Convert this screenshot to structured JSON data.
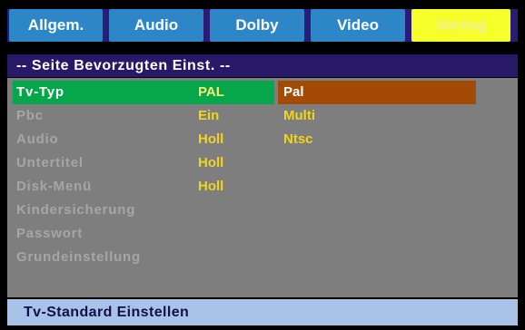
{
  "tabs": [
    {
      "label": "Allgem."
    },
    {
      "label": "Audio"
    },
    {
      "label": "Dolby"
    },
    {
      "label": "Video"
    },
    {
      "label": "Vorzug"
    }
  ],
  "header": {
    "title": "-- Seite Bevorzugten Einst. --"
  },
  "menu": {
    "items": [
      {
        "label": "Tv-Typ",
        "value": "PAL"
      },
      {
        "label": "Pbc",
        "value": "Ein"
      },
      {
        "label": "Audio",
        "value": "Holl"
      },
      {
        "label": "Untertitel",
        "value": "Holl"
      },
      {
        "label": "Disk-Menü",
        "value": "Holl"
      },
      {
        "label": "Kindersicherung",
        "value": ""
      },
      {
        "label": "Passwort",
        "value": ""
      },
      {
        "label": "Grundeinstellung",
        "value": ""
      }
    ]
  },
  "options": {
    "items": [
      "Pal",
      "Multi",
      "Ntsc"
    ]
  },
  "footer": {
    "text": "Tv-Standard Einstellen"
  },
  "colors": {
    "tab_bg": "#2d86c8",
    "tab_active_bg": "#f6ff2a",
    "header_bg": "#281868",
    "panel_bg": "#7e7e7e",
    "row_highlight": "#06a64a",
    "option_highlight": "#a34b06",
    "value_text": "#f2d51a",
    "footer_bg": "#a9c3e8"
  }
}
